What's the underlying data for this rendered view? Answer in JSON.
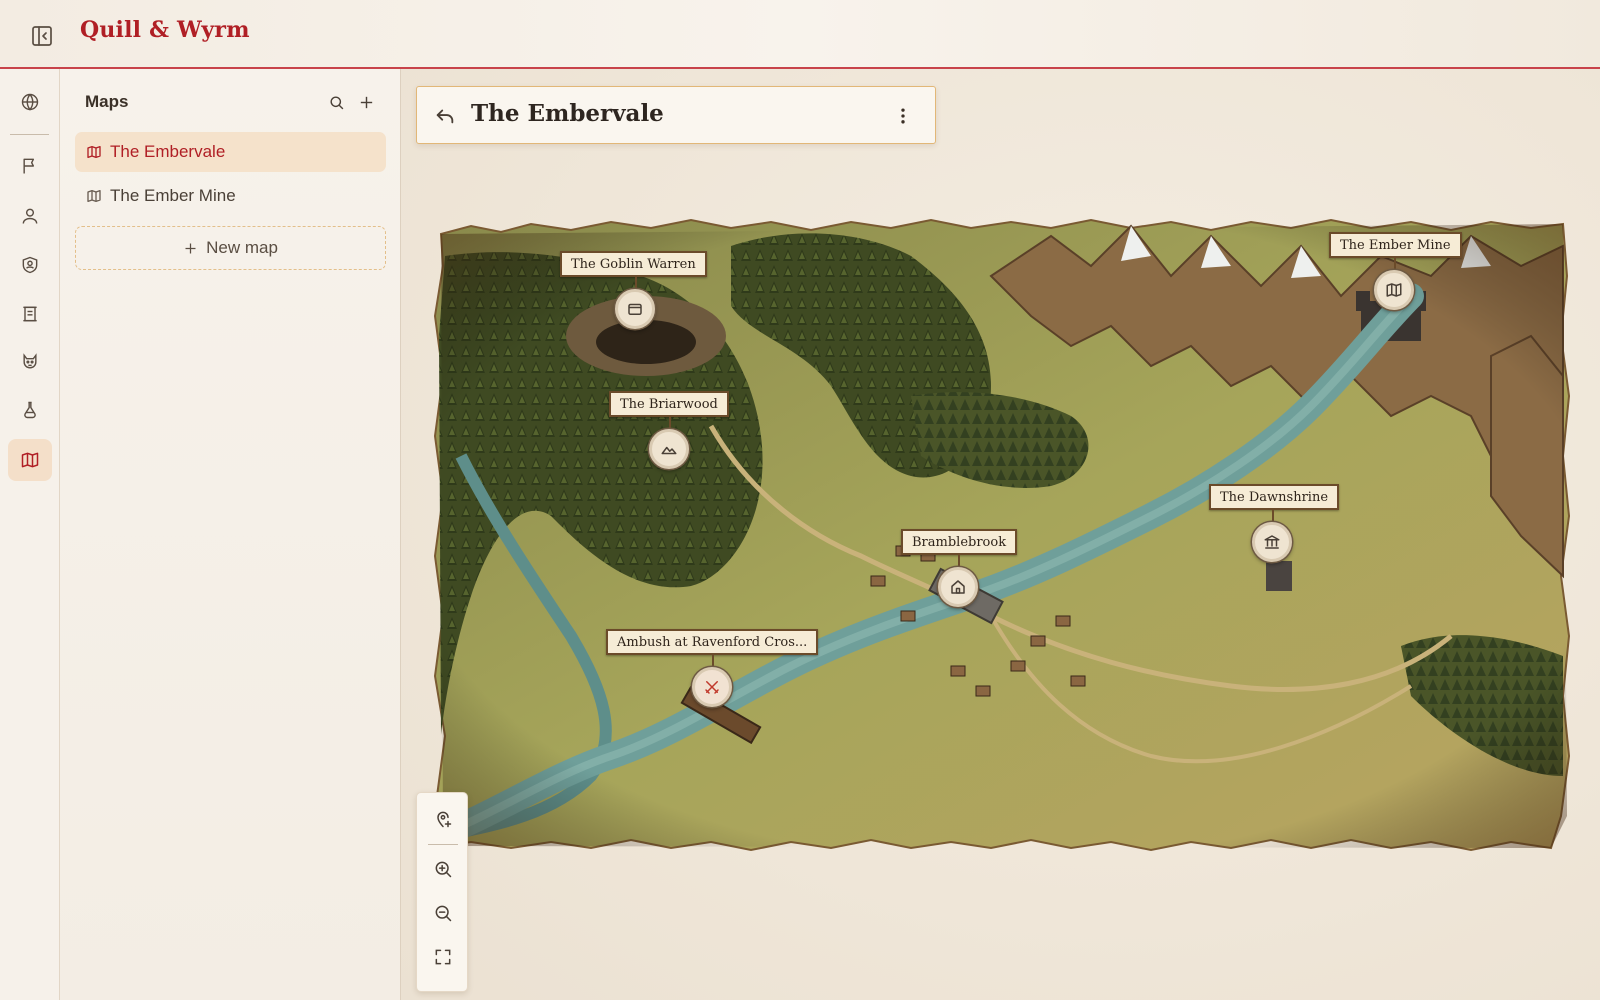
{
  "app": {
    "title": "Quill & Wyrm"
  },
  "rail": {
    "items": [
      {
        "icon": "globe-icon"
      },
      {
        "icon": "flag-icon"
      },
      {
        "icon": "person-icon"
      },
      {
        "icon": "shield-person-icon"
      },
      {
        "icon": "scroll-icon"
      },
      {
        "icon": "beast-icon"
      },
      {
        "icon": "flask-icon"
      },
      {
        "icon": "map-icon",
        "active": true
      }
    ]
  },
  "maps_panel": {
    "title": "Maps",
    "items": [
      {
        "label": "The Embervale",
        "active": true
      },
      {
        "label": "The Ember Mine",
        "active": false
      }
    ],
    "new_map_label": "New map"
  },
  "map_view": {
    "title": "The Embervale",
    "pins": [
      {
        "label": "The Goblin Warren",
        "icon": "cave-icon"
      },
      {
        "label": "The Briarwood",
        "icon": "mountain-icon"
      },
      {
        "label": "Bramblebrook",
        "icon": "house-icon"
      },
      {
        "label": "Ambush at Ravenford Cros...",
        "icon": "crossed-swords-icon",
        "color": "#c0392b"
      },
      {
        "label": "The Dawnshrine",
        "icon": "temple-icon"
      },
      {
        "label": "The Ember Mine",
        "icon": "map-icon"
      }
    ]
  },
  "colors": {
    "accent": "#b01f25",
    "border_gold": "#e2b777",
    "active_bg": "#f5e2cb"
  }
}
